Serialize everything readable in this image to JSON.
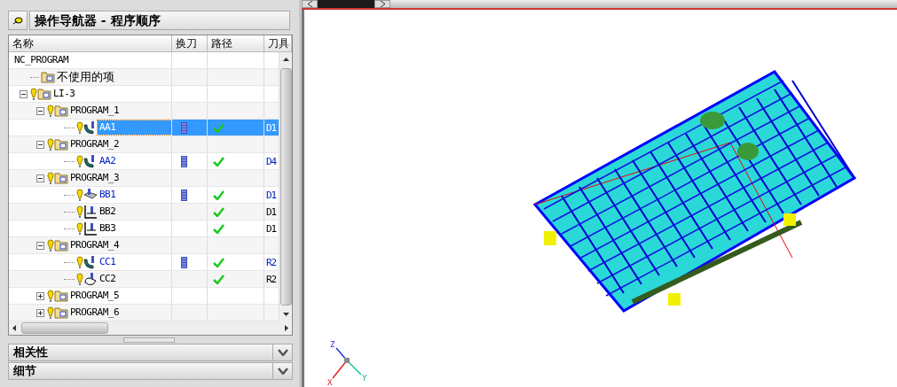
{
  "panel": {
    "title": "操作导航器 - 程序顺序"
  },
  "table": {
    "columns": [
      "名称",
      "换刀",
      "路径",
      "刀具"
    ],
    "tree": [
      {
        "name": "NC_PROGRAM",
        "kind": "root",
        "selected": false,
        "children": [
          {
            "name": "不使用的项",
            "kind": "unused",
            "selected": false
          },
          {
            "name": "LI-3",
            "kind": "program",
            "expanded": true,
            "selected": false,
            "children": [
              {
                "name": "PROGRAM_1",
                "kind": "program",
                "expanded": true,
                "selected": false,
                "children": [
                  {
                    "name": "AA1",
                    "kind": "contour",
                    "selected": true,
                    "tool_change": true,
                    "path_ok": true,
                    "tool": "D1",
                    "changed": true
                  }
                ]
              },
              {
                "name": "PROGRAM_2",
                "kind": "program",
                "expanded": true,
                "selected": false,
                "children": [
                  {
                    "name": "AA2",
                    "kind": "contour",
                    "selected": false,
                    "tool_change": true,
                    "path_ok": true,
                    "tool": "D4",
                    "changed": true
                  }
                ]
              },
              {
                "name": "PROGRAM_3",
                "kind": "program",
                "expanded": true,
                "selected": false,
                "children": [
                  {
                    "name": "BB1",
                    "kind": "cavity",
                    "selected": false,
                    "tool_change": true,
                    "path_ok": true,
                    "tool": "D1",
                    "changed": true
                  },
                  {
                    "name": "BB2",
                    "kind": "planar",
                    "selected": false,
                    "tool_change": false,
                    "path_ok": true,
                    "tool": "D1",
                    "changed": false
                  },
                  {
                    "name": "BB3",
                    "kind": "planar",
                    "selected": false,
                    "tool_change": false,
                    "path_ok": true,
                    "tool": "D1",
                    "changed": false
                  }
                ]
              },
              {
                "name": "PROGRAM_4",
                "kind": "program",
                "expanded": true,
                "selected": false,
                "children": [
                  {
                    "name": "CC1",
                    "kind": "contour",
                    "selected": false,
                    "tool_change": true,
                    "path_ok": true,
                    "tool": "R2",
                    "changed": true
                  },
                  {
                    "name": "CC2",
                    "kind": "surface",
                    "selected": false,
                    "tool_change": false,
                    "path_ok": true,
                    "tool": "R2",
                    "changed": false
                  }
                ]
              },
              {
                "name": "PROGRAM_5",
                "kind": "program",
                "expanded": false,
                "selected": false
              },
              {
                "name": "PROGRAM_6",
                "kind": "program",
                "expanded": false,
                "selected": false
              }
            ]
          }
        ]
      }
    ]
  },
  "sections": [
    {
      "title": "相关性",
      "expanded": false
    },
    {
      "title": "细节",
      "expanded": false
    }
  ],
  "viewport": {
    "axes": [
      "X",
      "Y",
      "Z"
    ]
  }
}
